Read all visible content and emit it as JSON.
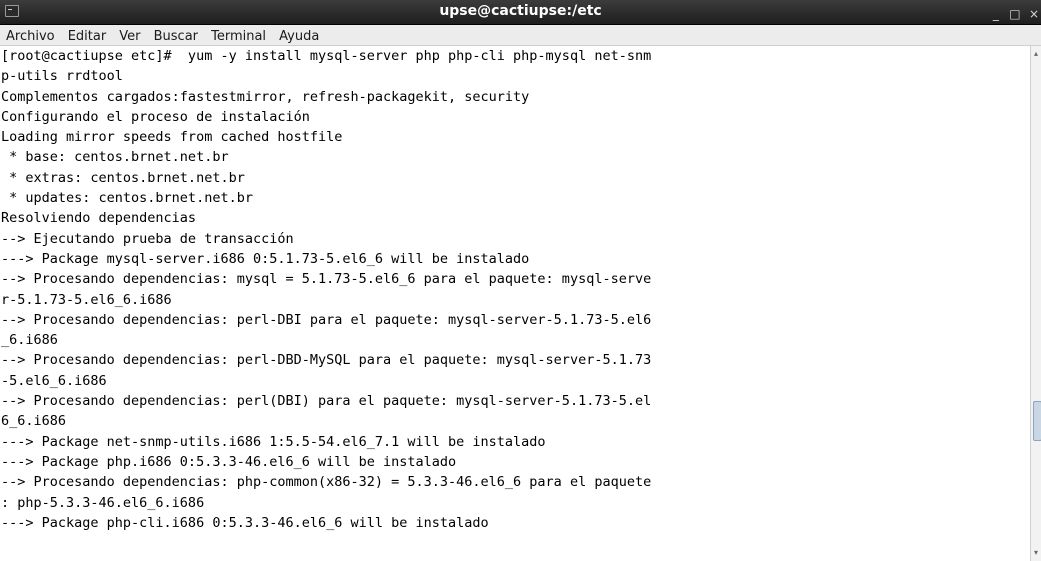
{
  "window": {
    "title": "upse@cactiupse:/etc",
    "app_icon": "terminal-icon",
    "controls": {
      "minimize": "_",
      "maximize": "□",
      "close": "×"
    }
  },
  "menubar": {
    "items": [
      "Archivo",
      "Editar",
      "Ver",
      "Buscar",
      "Terminal",
      "Ayuda"
    ]
  },
  "terminal": {
    "lines": [
      "[root@cactiupse etc]#  yum -y install mysql-server php php-cli php-mysql net-snm",
      "p-utils rrdtool",
      "Complementos cargados:fastestmirror, refresh-packagekit, security",
      "Configurando el proceso de instalación",
      "Loading mirror speeds from cached hostfile",
      " * base: centos.brnet.net.br",
      " * extras: centos.brnet.net.br",
      " * updates: centos.brnet.net.br",
      "Resolviendo dependencias",
      "--> Ejecutando prueba de transacción",
      "---> Package mysql-server.i686 0:5.1.73-5.el6_6 will be instalado",
      "--> Procesando dependencias: mysql = 5.1.73-5.el6_6 para el paquete: mysql-serve",
      "r-5.1.73-5.el6_6.i686",
      "--> Procesando dependencias: perl-DBI para el paquete: mysql-server-5.1.73-5.el6",
      "_6.i686",
      "--> Procesando dependencias: perl-DBD-MySQL para el paquete: mysql-server-5.1.73",
      "-5.el6_6.i686",
      "--> Procesando dependencias: perl(DBI) para el paquete: mysql-server-5.1.73-5.el",
      "6_6.i686",
      "---> Package net-snmp-utils.i686 1:5.5-54.el6_7.1 will be instalado",
      "---> Package php.i686 0:5.3.3-46.el6_6 will be instalado",
      "--> Procesando dependencias: php-common(x86-32) = 5.3.3-46.el6_6 para el paquete",
      ": php-5.3.3-46.el6_6.i686",
      "---> Package php-cli.i686 0:5.3.3-46.el6_6 will be instalado"
    ]
  },
  "scrollbar": {
    "up_icon": "▴",
    "down_icon": "▾"
  },
  "colors": {
    "titlebar": "#2b2b2b",
    "title_text": "#ffffff",
    "menubar": "#ececec",
    "terminal_bg": "#ffffff",
    "terminal_fg": "#000000"
  }
}
